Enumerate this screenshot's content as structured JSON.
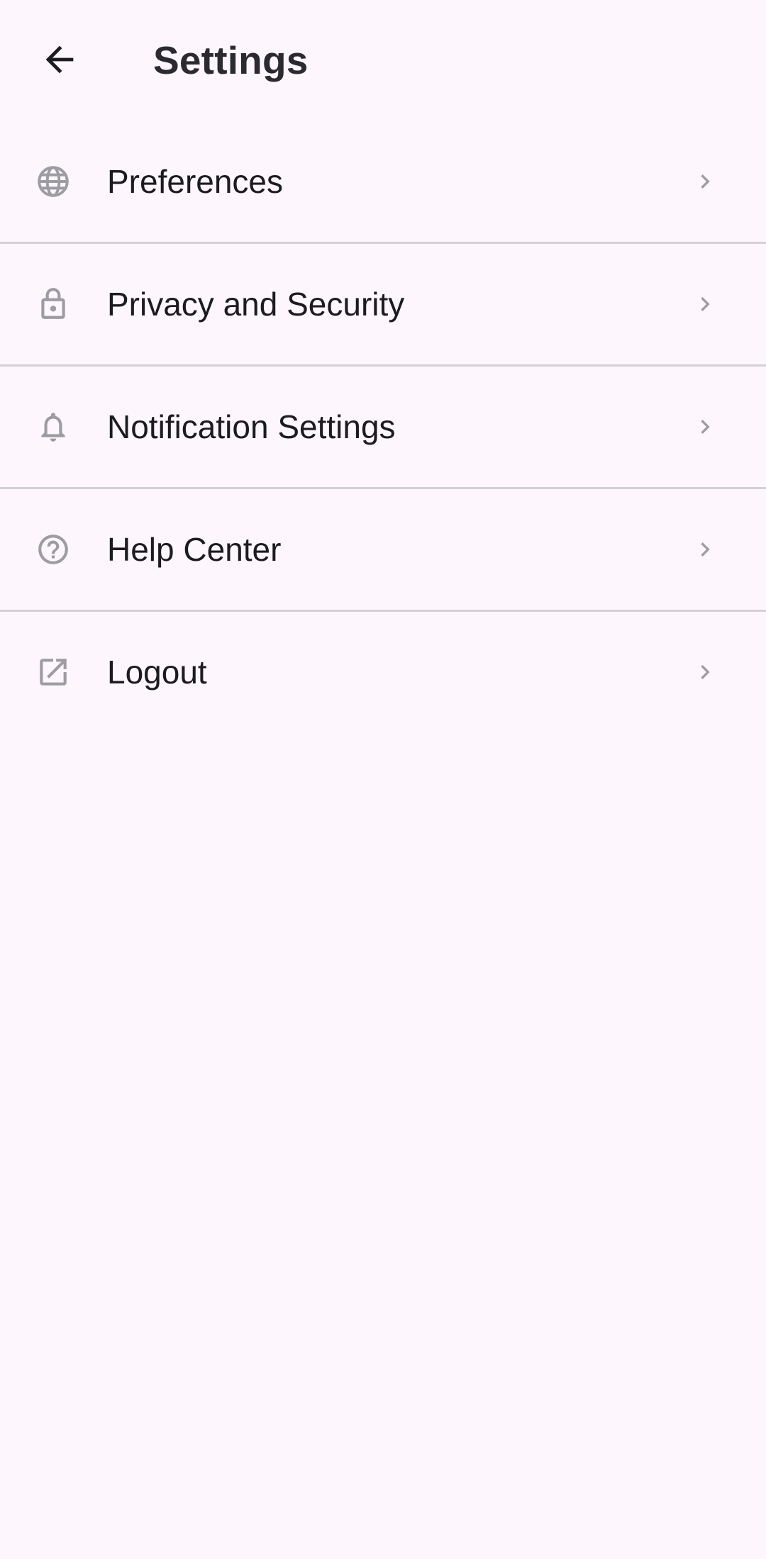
{
  "header": {
    "title": "Settings",
    "back_icon": "arrow-back-icon"
  },
  "colors": {
    "background": "#fdf7fd",
    "text": "#1c1b1f",
    "icon": "#9e9ca3",
    "divider": "#d3d1d6"
  },
  "settings": {
    "items": [
      {
        "label": "Preferences",
        "icon": "globe-icon"
      },
      {
        "label": "Privacy and Security",
        "icon": "lock-icon"
      },
      {
        "label": "Notification Settings",
        "icon": "bell-icon"
      },
      {
        "label": "Help Center",
        "icon": "help-circle-icon"
      },
      {
        "label": "Logout",
        "icon": "open-external-icon"
      }
    ]
  }
}
